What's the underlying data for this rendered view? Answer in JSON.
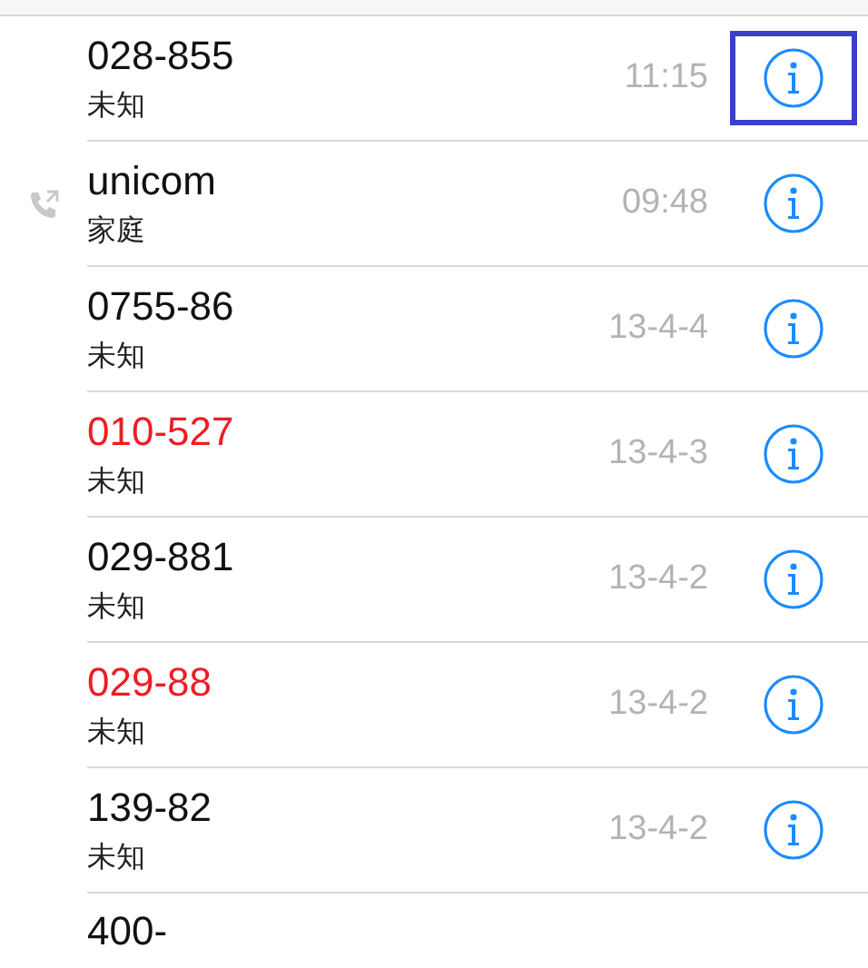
{
  "calls": [
    {
      "number": "028-855",
      "label": "未知",
      "time": "11:15",
      "missed": false,
      "outgoing": false,
      "highlighted": true
    },
    {
      "number": "unicom",
      "label": "家庭",
      "time": "09:48",
      "missed": false,
      "outgoing": true,
      "highlighted": false
    },
    {
      "number": "0755-86",
      "label": "未知",
      "time": "13-4-4",
      "missed": false,
      "outgoing": false,
      "highlighted": false
    },
    {
      "number": "010-527",
      "label": "未知",
      "time": "13-4-3",
      "missed": true,
      "outgoing": false,
      "highlighted": false
    },
    {
      "number": "029-881",
      "label": "未知",
      "time": "13-4-2",
      "missed": false,
      "outgoing": false,
      "highlighted": false
    },
    {
      "number": "029-88",
      "label": "未知",
      "time": "13-4-2",
      "missed": true,
      "outgoing": false,
      "highlighted": false
    },
    {
      "number": "139-82",
      "label": "未知",
      "time": "13-4-2",
      "missed": false,
      "outgoing": false,
      "highlighted": false
    },
    {
      "number": "400-",
      "missed": false,
      "outgoing": false
    }
  ]
}
